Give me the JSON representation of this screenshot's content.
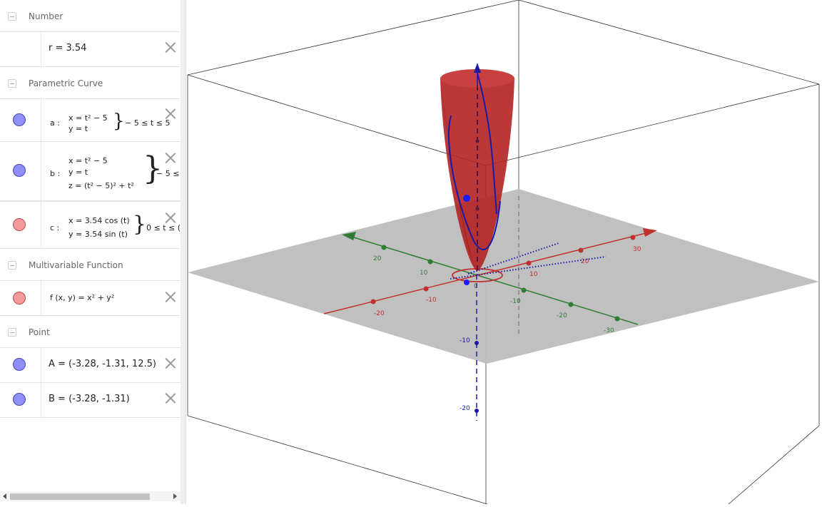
{
  "groups": {
    "number": "Number",
    "parametric": "Parametric Curve",
    "multivariable": "Multivariable Function",
    "point": "Point"
  },
  "items": {
    "r": {
      "text": "r = 3.54"
    },
    "a": {
      "label": "a :",
      "line1": "x = t² − 5",
      "line2": "y = t",
      "range": "− 5 ≤ t ≤ 5",
      "color": "#8f8ff7"
    },
    "b": {
      "label": "b :",
      "line1": "x = t² − 5",
      "line2": "y = t",
      "line3": "z = (t² − 5)² + t²",
      "range": "− 5 ≤",
      "color": "#8f8ff7"
    },
    "c": {
      "label": "c :",
      "line1": "x = 3.54  cos (t)",
      "line2": "y = 3.54  sin (t)",
      "range": "0 ≤ t ≤ (",
      "color": "#f49a9a"
    },
    "f": {
      "text": "f (x, y)  =  x² + y²",
      "color": "#f49a9a"
    },
    "A": {
      "text": "A = (-3.28, -1.31, 12.5)",
      "color": "#8f8ff7"
    },
    "B": {
      "text": "B = (-3.28, -1.31)",
      "color": "#8f8ff7"
    }
  },
  "view3d": {
    "axis_colors": {
      "x": "#c0302c",
      "y": "#2e7d32",
      "z": "#1a1aa8"
    },
    "surface_color": "#b22222",
    "plane_color": "#bdbdbd",
    "tick_labels": {
      "x": [
        "-20",
        "-10",
        "10",
        "20",
        "30"
      ],
      "y": [
        "20",
        "10",
        "-10",
        "-20",
        "-30"
      ],
      "z": [
        "-10",
        "-20"
      ],
      "origin": "0"
    }
  }
}
